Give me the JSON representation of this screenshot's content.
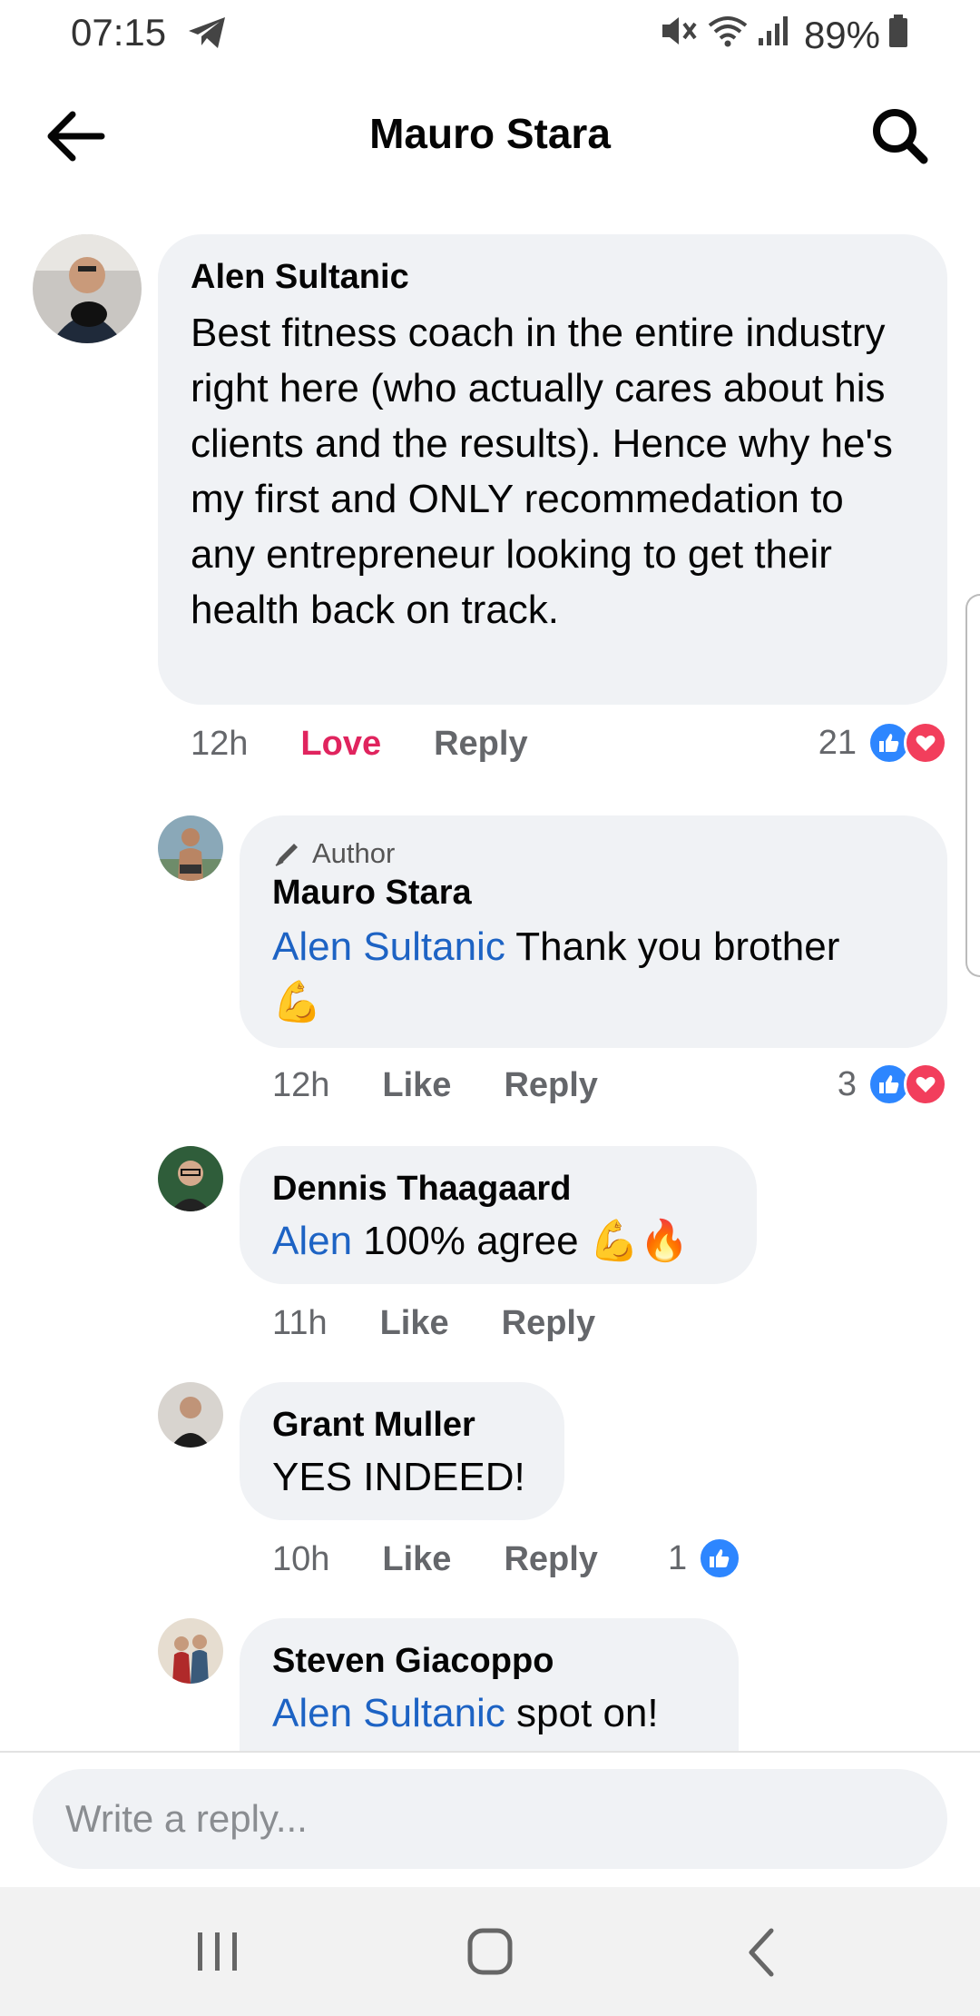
{
  "status_bar": {
    "time": "07:15",
    "battery": "89%"
  },
  "header": {
    "title": "Mauro Stara"
  },
  "comments": [
    {
      "author": "Alen Sultanic",
      "text": "Best fitness coach in the entire industry right here (who actually cares about his clients and the results). Hence why he's my first and ONLY recommedation to any entrepreneur looking to get their health back on track.",
      "time": "12h",
      "reaction_label": "Love",
      "reply_label": "Reply",
      "reaction_count": "21"
    }
  ],
  "replies": [
    {
      "author_tag": "Author",
      "author": "Mauro Stara",
      "mention": "Alen Sultanic",
      "text": " Thank you brother",
      "emoji": "💪",
      "time": "12h",
      "like_label": "Like",
      "reply_label": "Reply",
      "reaction_count": "3"
    },
    {
      "author": "Dennis Thaagaard",
      "mention": "Alen",
      "text": " 100% agree ",
      "emoji": "💪🔥",
      "time": "11h",
      "like_label": "Like",
      "reply_label": "Reply"
    },
    {
      "author": "Grant Muller",
      "text": "YES INDEED!",
      "time": "10h",
      "like_label": "Like",
      "reply_label": "Reply",
      "reaction_count": "1"
    },
    {
      "author": "Steven Giacoppo",
      "mention": "Alen Sultanic",
      "text": " spot on!"
    }
  ],
  "reply_box": {
    "placeholder": "Write a reply..."
  },
  "colors": {
    "mention": "#1d63c4",
    "love": "#e0245e",
    "like_blue": "#2d86ff",
    "heart_red": "#f23e5c",
    "bubble": "#f0f2f5"
  },
  "icons": [
    "telegram-icon",
    "mute-icon",
    "wifi-icon",
    "signal-icon",
    "battery-icon",
    "back-arrow-icon",
    "search-icon",
    "recent-apps-icon",
    "home-icon",
    "nav-back-icon"
  ]
}
